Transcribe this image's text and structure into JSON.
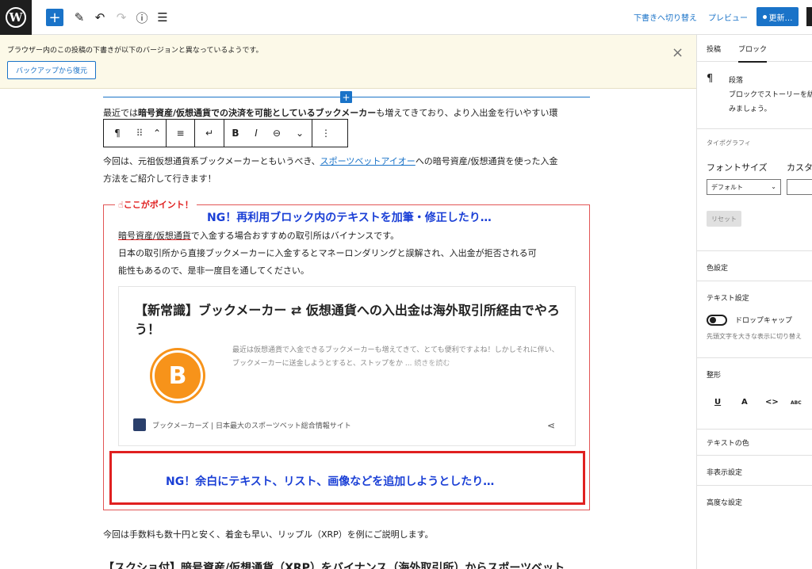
{
  "topbar": {
    "logo": "W",
    "add_icon": "+",
    "pen_icon": "✎",
    "undo_icon": "↶",
    "redo_icon": "↷",
    "info_icon": "ⓘ",
    "list_icon": "☰",
    "draft_link": "下書きへ切り替え",
    "preview_link": "プレビュー",
    "update_label": "更新…"
  },
  "notice": {
    "text": "ブラウザー内のこの投稿の下書きが以下のバージョンと異なっているようです。",
    "restore_button": "バックアップから復元",
    "close": "×"
  },
  "editor": {
    "para1_prefix": "最近では",
    "para1_bold": "暗号資産/仮想通貨での決済を可能としているブックメーカー",
    "para1_suffix": "も増えてきており、より入出金を行いやすい環",
    "para2_prefix": "今回は、元祖仮想通貨系ブックメーカーともいうべき、",
    "para2_link": "スポーツベットアイオー",
    "para2_suffix": "への暗号資産/仮想通貨を使った入金",
    "para2_line2": "方法をご紹介して行きます！",
    "toolbar": {
      "paragraph_icon": "¶",
      "drag_icon": "⠿",
      "move_icon": "⌃",
      "align_icon": "≡",
      "return_icon": "↵",
      "bold": "B",
      "italic": "I",
      "link_icon": "⊖",
      "chevron": "⌄",
      "more": "⋮"
    },
    "callout": {
      "label": "☝ここがポイント！",
      "ng1": "NG！再利用ブロック内のテキストを加筆・修正したり…",
      "line1_underlined": "暗号資産/仮想通貨",
      "line1_rest": "で入金する場合おすすめの取引所はバイナンスです。",
      "line2": "日本の取引所から直接ブックメーカーに入金するとマネーロンダリングと誤解され、入出金が拒否される可",
      "line3": "能性もあるので、是非一度目を通してください。",
      "card": {
        "title": "【新常識】ブックメーカー ⇄ 仮想通貨への入出金は海外取引所経由でやろう！",
        "coin": "B",
        "excerpt": "最近は仮想通貨で入金できるブックメーカーも増えてきて、とても便利ですよね！しかしそれに伴い、ブックメーカーに送金しようとすると、ストップをか ...",
        "more": "続きを読む",
        "site": "ブックメーカーズ | 日本最大のスポーツベット総合情報サイト",
        "share_icon": "⋖"
      },
      "ng2": "NG！余白にテキスト、リスト、画像などを追加しようとしたり…"
    },
    "para3": "今回は手数料も数十円と安く、着金も早い、リップル（XRP）を例にご説明します。",
    "para4": "【スクショ付】暗号資産/仮想通貨（XRP）をバイナンス（海外取引所）からスポーツベット"
  },
  "sidebar": {
    "tab_post": "投稿",
    "tab_block": "ブロック",
    "block_icon": "¶",
    "block_name": "段落",
    "block_desc": "ブロックでストーリーを紡",
    "block_desc2": "みましょう。",
    "typography": "タイポグラフィ",
    "font_size": "フォントサイズ",
    "custom": "カスタ",
    "default": "デフォルト",
    "reset": "リセット",
    "color_settings": "色設定",
    "text_settings": "テキスト設定",
    "drop_cap": "ドロップキャップ",
    "drop_cap_desc": "先頭文字を大きな表示に切り替え",
    "formatting": "整形",
    "fmt_u": "U",
    "fmt_a": "A",
    "fmt_code": "<>",
    "fmt_abc": "ABC",
    "text_color": "テキストの色",
    "hidden_settings": "非表示設定",
    "advanced": "高度な設定"
  }
}
